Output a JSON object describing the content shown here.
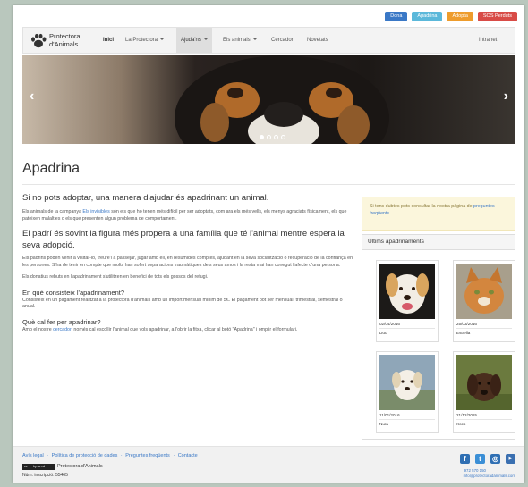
{
  "top_actions": {
    "dona": "Dona",
    "apadrina": "Apadrina",
    "adopta": "Adopta",
    "sos": "SOS Perduts"
  },
  "logo": {
    "line1": "Protectora",
    "line2": "d'Animals"
  },
  "nav": {
    "home": "Inici",
    "protectora": "La Protectora",
    "ajudans": "Ajuda'ns",
    "animals": "Els animals",
    "cercador": "Cercador",
    "novetats": "Novetats",
    "intranet": "Intranet"
  },
  "carousel": {
    "slides": 4,
    "active": 0
  },
  "title": "Apadrina",
  "main": {
    "lead": "Si no pots adoptar, una manera d'ajudar és apadrinant un animal.",
    "p1_a": "Els animals de la campanya ",
    "p1_link": "Els invisibles",
    "p1_b": " són els que ho tenen més difícil per ser adoptats, com ara els més vells, els menys agraciats físicament, els que pateixen malalties o els que presenten algun problema de comportament.",
    "h2": "El padrí és sovint la figura més propera a una família que té l'animal mentre espera la seva adopció.",
    "p2": "Els padrins poden venir a visitar-lo, treure'l a passejar, jugar amb ell, en resumides comptes, ajudant en la seva socialització o recuperació de la confiança en les persones. S'ha de tenir en compte que molts han sofert separacions traumàtiques dels seus amos i la resta mai han conegut l'afecte d'una persona.",
    "p3": "Els donatius rebuts en l'apadrinament s'utilitzen en benefici de tots els gossos del refugi.",
    "h3a": "En què consisteix l'apadrinament?",
    "p4": "Consisteix en un pagament realitzat a la protectora d'animals amb un import mensual mínim de 5€. El pagament pot ser mensual, trimestral, semestral o anual.",
    "h3b": "Què cal fer per apadrinar?",
    "p5_a": "Amb el nostre ",
    "p5_link": "cercador",
    "p5_b": ", només cal escollir l'animal que vols apadrinar, a l'obrir la fitxa, clicar al botó \"Apadrina\" i omplir el formulari."
  },
  "sidebar": {
    "alert_a": "Si tens dubtes pots consultar la nostra pàgina de ",
    "alert_link": "preguntes freqüents",
    "alert_b": ".",
    "panel_title": "Últims apadrinaments",
    "items": [
      {
        "date": "02/04/2016",
        "name": "Duc"
      },
      {
        "date": "25/03/2016",
        "name": "Estrella"
      },
      {
        "date": "11/01/2016",
        "name": "Nura"
      },
      {
        "date": "21/12/2015",
        "name": "Xoco"
      }
    ]
  },
  "footer": {
    "link1": "Avís legal",
    "link2": "Política de protecció de dades",
    "link3": "Preguntes freqüents",
    "link4": "Contacte",
    "sep": "·",
    "org": "Protectora d'Animals",
    "reg": "Núm. inscripció: 55465",
    "phone": "972 570 150",
    "email": "info@protectoradanimals.com"
  },
  "colors": {
    "primary": "#3a78c6",
    "info": "#5bb8da",
    "warning": "#ee9c2c",
    "danger": "#d84b46"
  }
}
